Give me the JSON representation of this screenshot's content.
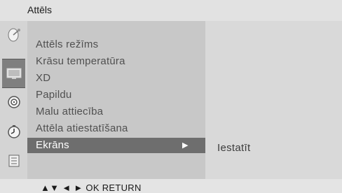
{
  "title": "Attēls",
  "icons": [
    {
      "name": "satellite-dish-icon",
      "active": false
    },
    {
      "name": "tv-screen-icon",
      "active": true
    },
    {
      "name": "speaker-icon",
      "active": false
    },
    {
      "name": "clock-icon",
      "active": false
    },
    {
      "name": "settings-icon",
      "active": false
    }
  ],
  "menu": {
    "items": [
      {
        "label": "Attēls režīms"
      },
      {
        "label": "Krāsu temperatūra"
      },
      {
        "label": "XD"
      },
      {
        "label": "Papildu"
      },
      {
        "label": "Malu attiecība"
      },
      {
        "label": "Attēla atiestatīšana"
      },
      {
        "label": "Ekrāns",
        "selected": true
      }
    ]
  },
  "submenu": {
    "label": "Iestatīt"
  },
  "footer": {
    "hints": "▲▼  ◄ ►  OK  RETURN"
  }
}
